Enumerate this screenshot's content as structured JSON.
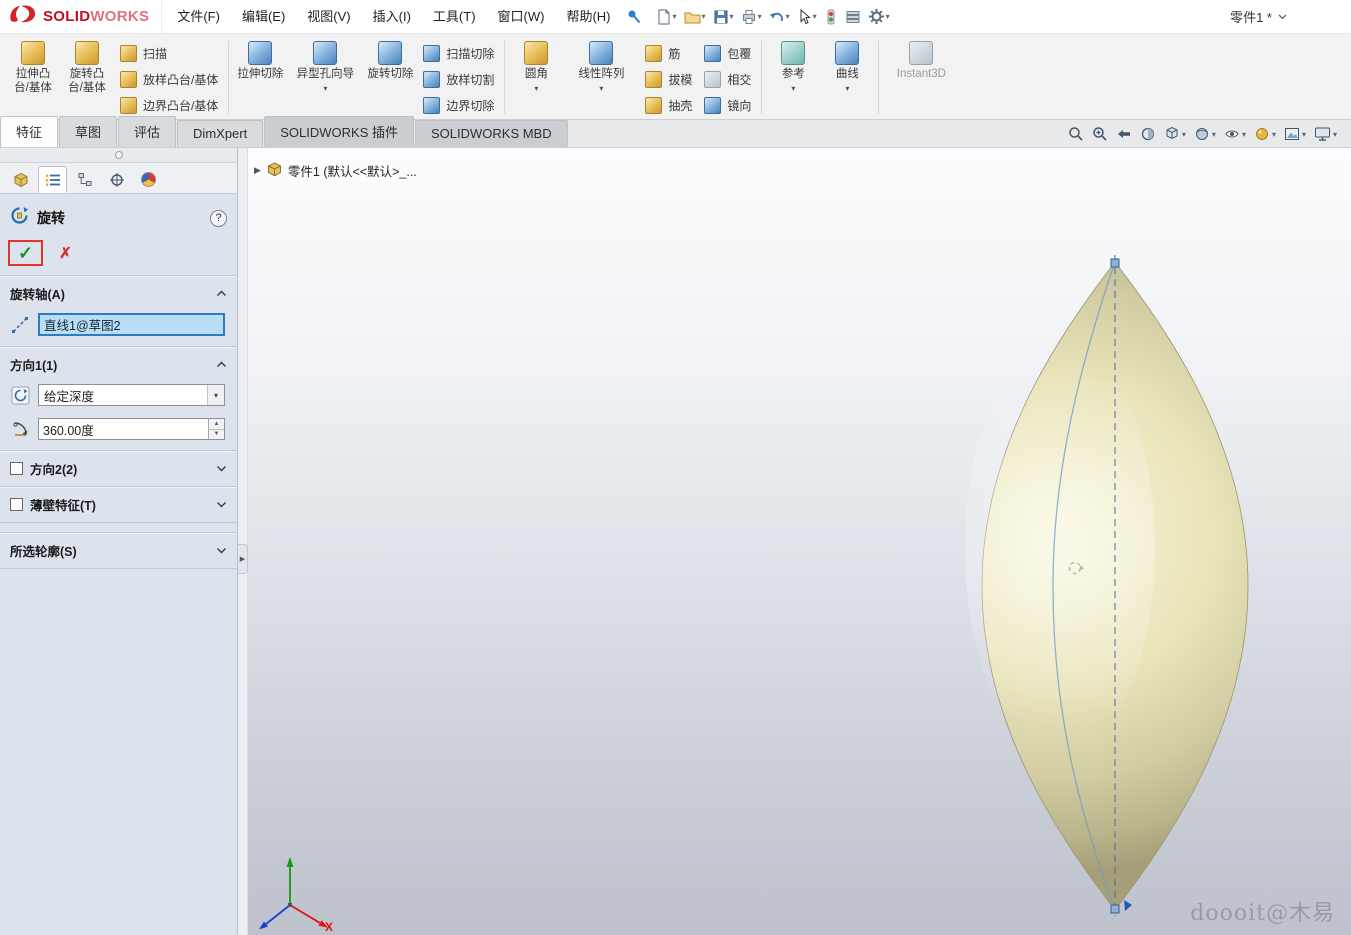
{
  "colors": {
    "brand_red": "#c10d20",
    "selection_fill": "#baddf6",
    "selection_border": "#2e7cc0",
    "ok_green": "#18912c",
    "cancel_red": "#d32f2f",
    "highlight_box_red": "#e53228",
    "axis_blue": "#3f6fa8",
    "model_cream": "#e9e4ba"
  },
  "app": {
    "brand_bold": "SOLID",
    "brand_light": "WORKS",
    "doc_title": "零件1 *"
  },
  "menubar": {
    "file": "文件(F)",
    "edit": "编辑(E)",
    "view": "视图(V)",
    "insert": "插入(I)",
    "tools": "工具(T)",
    "window": "窗口(W)",
    "help": "帮助(H)"
  },
  "ribbon": {
    "extrude_boss": "拉伸凸台/基体",
    "revolve_boss": "旋转凸台/基体",
    "sweep": "扫描",
    "loft": "放样凸台/基体",
    "boundary": "边界凸台/基体",
    "extruded_cut": "拉伸切除",
    "hole_wizard": "异型孔向导",
    "revolved_cut": "旋转切除",
    "swept_cut": "扫描切除",
    "lofted_cut": "放样切割",
    "boundary_cut": "边界切除",
    "fillet": "圆角",
    "linear_pattern": "线性阵列",
    "rib": "筋",
    "draft": "拔模",
    "shell": "抽壳",
    "wrap": "包覆",
    "intersect": "相交",
    "mirror": "镜向",
    "reference": "参考",
    "curves": "曲线",
    "instant3d": "Instant3D"
  },
  "tabs": {
    "features": "特征",
    "sketch": "草图",
    "evaluate": "评估",
    "dimxpert": "DimXpert",
    "addins": "SOLIDWORKS 插件",
    "mbd": "SOLIDWORKS MBD"
  },
  "pm": {
    "title": "旋转",
    "axis_title": "旋转轴(A)",
    "axis_value": "直线1@草图2",
    "dir1_title": "方向1(1)",
    "end_condition": "给定深度",
    "angle_value": "360.00度",
    "dir2_title": "方向2(2)",
    "thin_title": "薄壁特征(T)",
    "contours_title": "所选轮廓(S)"
  },
  "viewport": {
    "breadcrumb": "零件1 (默认<<默认>_...",
    "watermark": "doooit@木易",
    "axis_x_label": "X"
  },
  "icons": {
    "dd": "▾",
    "ok": "✓",
    "cancel": "✗",
    "flyout": "▶",
    "spin_up": "▲",
    "spin_down": "▼",
    "help": "?"
  }
}
